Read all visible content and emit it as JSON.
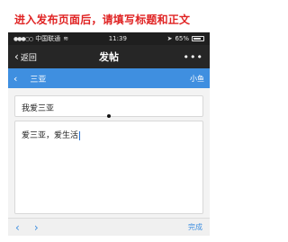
{
  "caption": "进入发布页面后，请填写标题和正文",
  "statusbar": {
    "signal": "●●●○○",
    "carrier": "中国联通",
    "time": "11:39",
    "battery_pct": "65%"
  },
  "navbar": {
    "back_label": "返回",
    "title": "发帖",
    "more_label": "•••"
  },
  "forum": {
    "name": "三亚",
    "user": "小鱼"
  },
  "post": {
    "title_value": "我爱三亚",
    "body_value": "爱三亚，爱生活"
  },
  "toolbar": {
    "done_label": "完成"
  },
  "colors": {
    "caption": "#e02424",
    "accent": "#3f8fe0",
    "navbar_bg": "#262626"
  }
}
